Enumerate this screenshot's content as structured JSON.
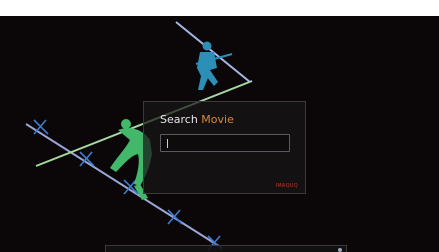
{
  "search_dialog": {
    "title_word": "Search",
    "title_accent_word": "Movie",
    "input_value": "",
    "brand": "IMAQUQ"
  },
  "colors": {
    "background": "#0b0708",
    "accent": "#d9873c",
    "figure_green": "#43b86a",
    "figure_blue": "#2c8fb8",
    "brand": "#c0392b"
  }
}
